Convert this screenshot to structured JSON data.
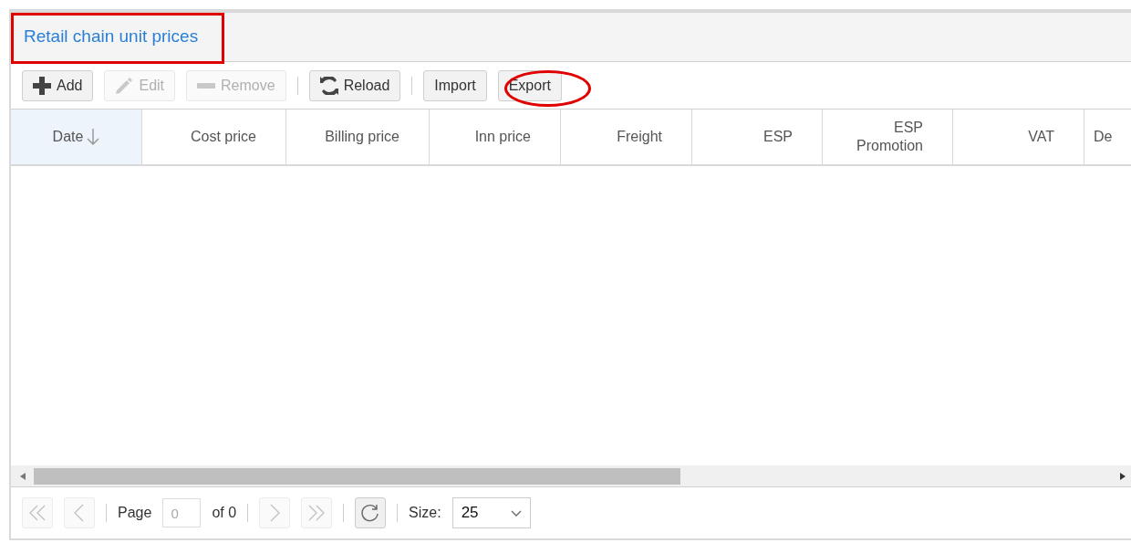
{
  "panel": {
    "title": "Retail chain unit prices"
  },
  "toolbar": [
    {
      "label": "Add",
      "disabled": false
    },
    {
      "label": "Edit",
      "disabled": true
    },
    {
      "label": "Remove",
      "disabled": true
    },
    {
      "label": "Reload",
      "disabled": false
    },
    {
      "label": "Import",
      "disabled": false
    },
    {
      "label": "Export",
      "disabled": false
    }
  ],
  "table": {
    "columns": [
      {
        "label": "Date",
        "sorted": true
      },
      {
        "label": "Cost price",
        "sorted": false
      },
      {
        "label": "Billing price",
        "sorted": false
      },
      {
        "label": "Inn price",
        "sorted": false
      },
      {
        "label": "Freight",
        "sorted": false
      },
      {
        "label": "ESP",
        "sorted": false
      },
      {
        "label": "ESP\nPromotion",
        "sorted": false
      },
      {
        "label": "VAT",
        "sorted": false
      },
      {
        "label": "De",
        "sorted": false
      }
    ]
  },
  "pager": {
    "first_disabled": true,
    "prev_disabled": true,
    "next_disabled": true,
    "last_disabled": true,
    "page_label": "Page",
    "page_value": "0",
    "of_label": "of 0",
    "size_label": "Size:",
    "size_value": "25"
  }
}
